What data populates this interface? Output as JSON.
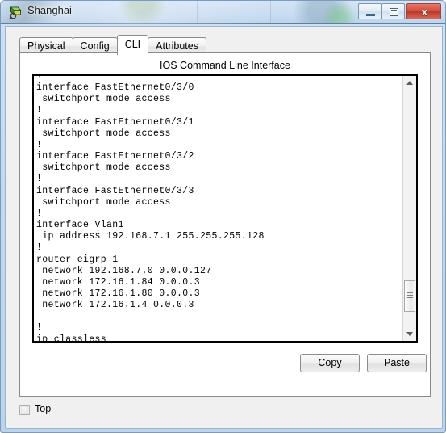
{
  "window": {
    "title": "Shanghai",
    "icon": "router-device-icon",
    "controls": {
      "minimize": "minimize-icon",
      "maximize": "maximize-icon",
      "close": "x",
      "close_label": "Close"
    },
    "colors": {
      "close_button": "#bd3826",
      "glass": "#c9ddf1",
      "frame_border": "#7a9bc0"
    }
  },
  "tabs": [
    {
      "label": "Physical",
      "active": false
    },
    {
      "label": "Config",
      "active": false
    },
    {
      "label": "CLI",
      "active": true
    },
    {
      "label": "Attributes",
      "active": false
    }
  ],
  "cli": {
    "header": "IOS Command Line Interface",
    "lines": [
      "!",
      "interface FastEthernet0/3/0",
      " switchport mode access",
      "!",
      "interface FastEthernet0/3/1",
      " switchport mode access",
      "!",
      "interface FastEthernet0/3/2",
      " switchport mode access",
      "!",
      "interface FastEthernet0/3/3",
      " switchport mode access",
      "!",
      "interface Vlan1",
      " ip address 192.168.7.1 255.255.255.128",
      "!",
      "router eigrp 1",
      " network 192.168.7.0 0.0.0.127",
      " network 172.16.1.84 0.0.0.3",
      " network 172.16.1.80 0.0.0.3",
      " network 172.16.1.4 0.0.0.3",
      "",
      "!",
      "ip classless",
      "!"
    ],
    "text": "!\ninterface FastEthernet0/3/0\n switchport mode access\n!\ninterface FastEthernet0/3/1\n switchport mode access\n!\ninterface FastEthernet0/3/2\n switchport mode access\n!\ninterface FastEthernet0/3/3\n switchport mode access\n!\ninterface Vlan1\n ip address 192.168.7.1 255.255.255.128\n!\nrouter eigrp 1\n network 192.168.7.0 0.0.0.127\n network 172.16.1.84 0.0.0.3\n network 172.16.1.80 0.0.0.3\n network 172.16.1.4 0.0.0.3\n\n!\nip classless\n!"
  },
  "buttons": {
    "copy": "Copy",
    "paste": "Paste"
  },
  "top_option": {
    "label": "Top",
    "checked": false
  },
  "scrollbar": {
    "up_arrow": "chevron-up-icon",
    "down_arrow": "chevron-down-icon"
  }
}
